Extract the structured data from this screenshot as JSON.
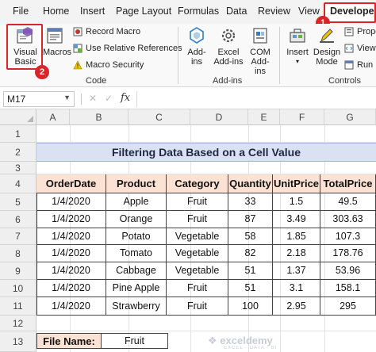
{
  "menu": {
    "tabs": [
      "File",
      "Home",
      "Insert",
      "Page Layout",
      "Formulas",
      "Data",
      "Review",
      "View"
    ],
    "active_tab": "Developer"
  },
  "callouts": {
    "developer_badge": "1",
    "visual_basic_badge": "2"
  },
  "ribbon": {
    "code": {
      "visual_basic": "Visual Basic",
      "macros": "Macros",
      "record_macro": "Record Macro",
      "use_relative_references": "Use Relative References",
      "macro_security": "Macro Security",
      "label": "Code"
    },
    "addins": {
      "addins": "Add-ins",
      "excel_addins": "Excel Add-ins",
      "com_addins": "COM Add-ins",
      "label": "Add-ins"
    },
    "controls": {
      "insert": "Insert",
      "design_mode": "Design Mode",
      "properties": "Prope",
      "view_code": "View",
      "run_dialog": "Run D",
      "label": "Controls"
    }
  },
  "formula_bar": {
    "name_box": "M17",
    "cancel": "✕",
    "enter": "✓",
    "fx": "fx",
    "value": ""
  },
  "grid": {
    "columns": [
      "A",
      "B",
      "C",
      "D",
      "E",
      "F",
      "G"
    ],
    "rows": [
      "1",
      "2",
      "3",
      "4",
      "5",
      "6",
      "7",
      "8",
      "9",
      "10",
      "11",
      "12",
      "13"
    ]
  },
  "sheet": {
    "title": "Filtering Data Based on a Cell Value",
    "headers": [
      "OrderDate",
      "Product",
      "Category",
      "Quantity",
      "UnitPrice",
      "TotalPrice"
    ],
    "rows": [
      [
        "1/4/2020",
        "Apple",
        "Fruit",
        "33",
        "1.5",
        "49.5"
      ],
      [
        "1/4/2020",
        "Orange",
        "Fruit",
        "87",
        "3.49",
        "303.63"
      ],
      [
        "1/4/2020",
        "Potato",
        "Vegetable",
        "58",
        "1.85",
        "107.3"
      ],
      [
        "1/4/2020",
        "Tomato",
        "Vegetable",
        "82",
        "2.18",
        "178.76"
      ],
      [
        "1/4/2020",
        "Cabbage",
        "Vegetable",
        "51",
        "1.37",
        "53.96"
      ],
      [
        "1/4/2020",
        "Pine Apple",
        "Fruit",
        "51",
        "3.1",
        "158.1"
      ],
      [
        "1/4/2020",
        "Strawberry",
        "Fruit",
        "100",
        "2.95",
        "295"
      ]
    ],
    "file_name_label": "File Name:",
    "file_name_value": "Fruit"
  },
  "watermark": {
    "name": "exceldemy",
    "tagline": "EXCEL · DATA · BI"
  },
  "colors": {
    "accent_red": "#d9252a",
    "title_fill": "#d9e1f2",
    "header_fill": "#fbe2d5"
  }
}
